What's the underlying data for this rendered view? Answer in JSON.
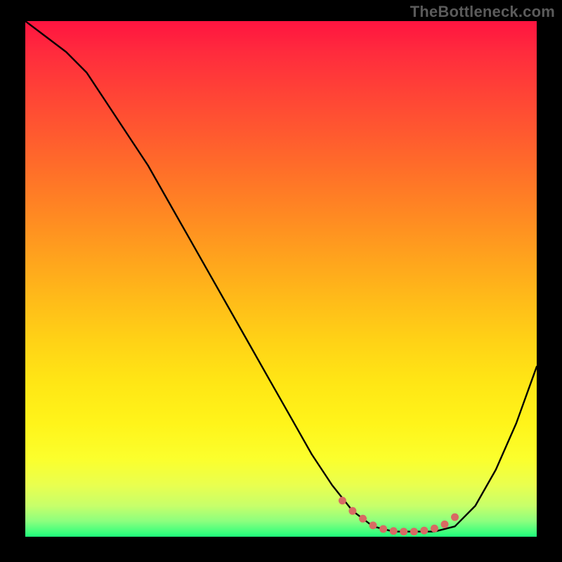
{
  "watermark": "TheBottleneck.com",
  "colors": {
    "page_bg": "#000000",
    "watermark_text": "#5b5b5b",
    "curve_stroke": "#000000",
    "highlight_dot": "#d86a63",
    "gradient_top": "#ff1440",
    "gradient_bottom": "#1fff7c"
  },
  "chart_data": {
    "type": "line",
    "title": "",
    "xlabel": "",
    "ylabel": "",
    "xlim": [
      0,
      100
    ],
    "ylim": [
      0,
      100
    ],
    "grid": false,
    "legend": false,
    "series": [
      {
        "name": "bottleneck-curve",
        "x": [
          0,
          4,
          8,
          12,
          16,
          20,
          24,
          28,
          32,
          36,
          40,
          44,
          48,
          52,
          56,
          60,
          64,
          68,
          72,
          76,
          80,
          84,
          88,
          92,
          96,
          100
        ],
        "y": [
          100,
          97,
          94,
          90,
          84,
          78,
          72,
          65,
          58,
          51,
          44,
          37,
          30,
          23,
          16,
          10,
          5,
          2,
          1,
          1,
          1,
          2,
          6,
          13,
          22,
          33
        ]
      }
    ],
    "highlight_region": {
      "meaning": "optimal / no-bottleneck zone along curve minimum",
      "points": [
        {
          "x": 62,
          "y": 7
        },
        {
          "x": 64,
          "y": 5
        },
        {
          "x": 66,
          "y": 3.5
        },
        {
          "x": 68,
          "y": 2.2
        },
        {
          "x": 70,
          "y": 1.5
        },
        {
          "x": 72,
          "y": 1.1
        },
        {
          "x": 74,
          "y": 1.0
        },
        {
          "x": 76,
          "y": 1.0
        },
        {
          "x": 78,
          "y": 1.2
        },
        {
          "x": 80,
          "y": 1.6
        },
        {
          "x": 82,
          "y": 2.4
        },
        {
          "x": 84,
          "y": 3.8
        }
      ]
    }
  }
}
